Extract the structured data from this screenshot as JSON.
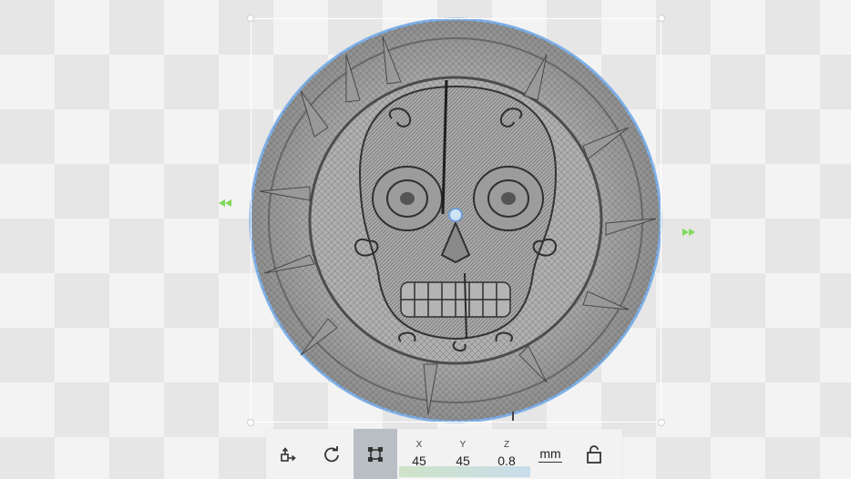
{
  "colors": {
    "accent_green": "#7ed957",
    "selection_outline": "#7fb0e8",
    "toolbar_bg": "#f2f2f2",
    "active_button_bg": "#b9bec4"
  },
  "toolbar": {
    "buttons": {
      "move_icon": "move-icon",
      "rotate_icon": "rotate-icon",
      "scale_icon": "scale-icon",
      "lock_icon": "lock-icon"
    },
    "dimensions": {
      "x_label": "X",
      "x_value": "45",
      "y_label": "Y",
      "y_value": "45",
      "z_label": "Z",
      "z_value": "0.8"
    },
    "unit": "mm"
  }
}
